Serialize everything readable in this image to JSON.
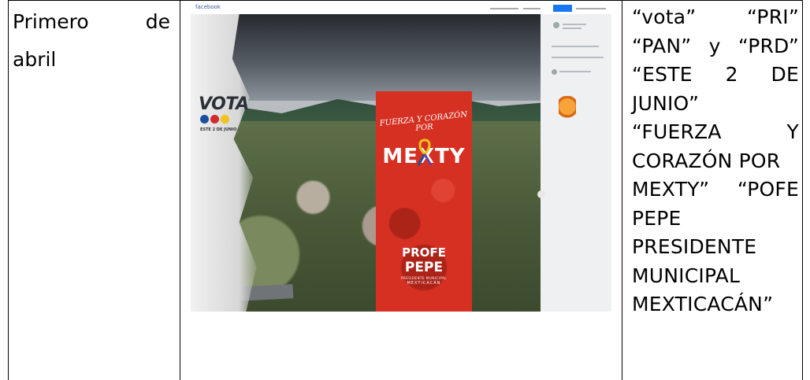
{
  "date_cell": {
    "line1_word1": "Primero",
    "line1_word2": "de",
    "line2": "abril"
  },
  "photo": {
    "facebook_logo": "facebook",
    "poster": {
      "vota": "VOTA",
      "vota_date": "ESTE 2 DE JUNIO",
      "fuerza": "FUERZA Y CORAZÓN POR",
      "mexty": "MEXTY",
      "profe": "PROFE",
      "pepe": "PEPE",
      "presidente_municipal": "PRESIDENTE MUNICIPAL",
      "mexticacan": "MEXTICACÁN"
    }
  },
  "text_cell": {
    "l1a": "“vota”",
    "l1b": "“PRI”",
    "l2a": "“PAN”",
    "l2b": "y",
    "l2c": "“PRD”",
    "l3a": "“ESTE",
    "l3b": "2",
    "l3c": "DE",
    "l4": "JUNIO”",
    "l5a": "“FUERZA",
    "l5b": "Y",
    "l6": "CORAZÓN POR",
    "l7a": "MEXTY”",
    "l7b": "“POFE",
    "l8": "PEPE",
    "l9": "PRESIDENTE",
    "l10": "MUNICIPAL",
    "l11": "MEXTICACÁN”"
  }
}
